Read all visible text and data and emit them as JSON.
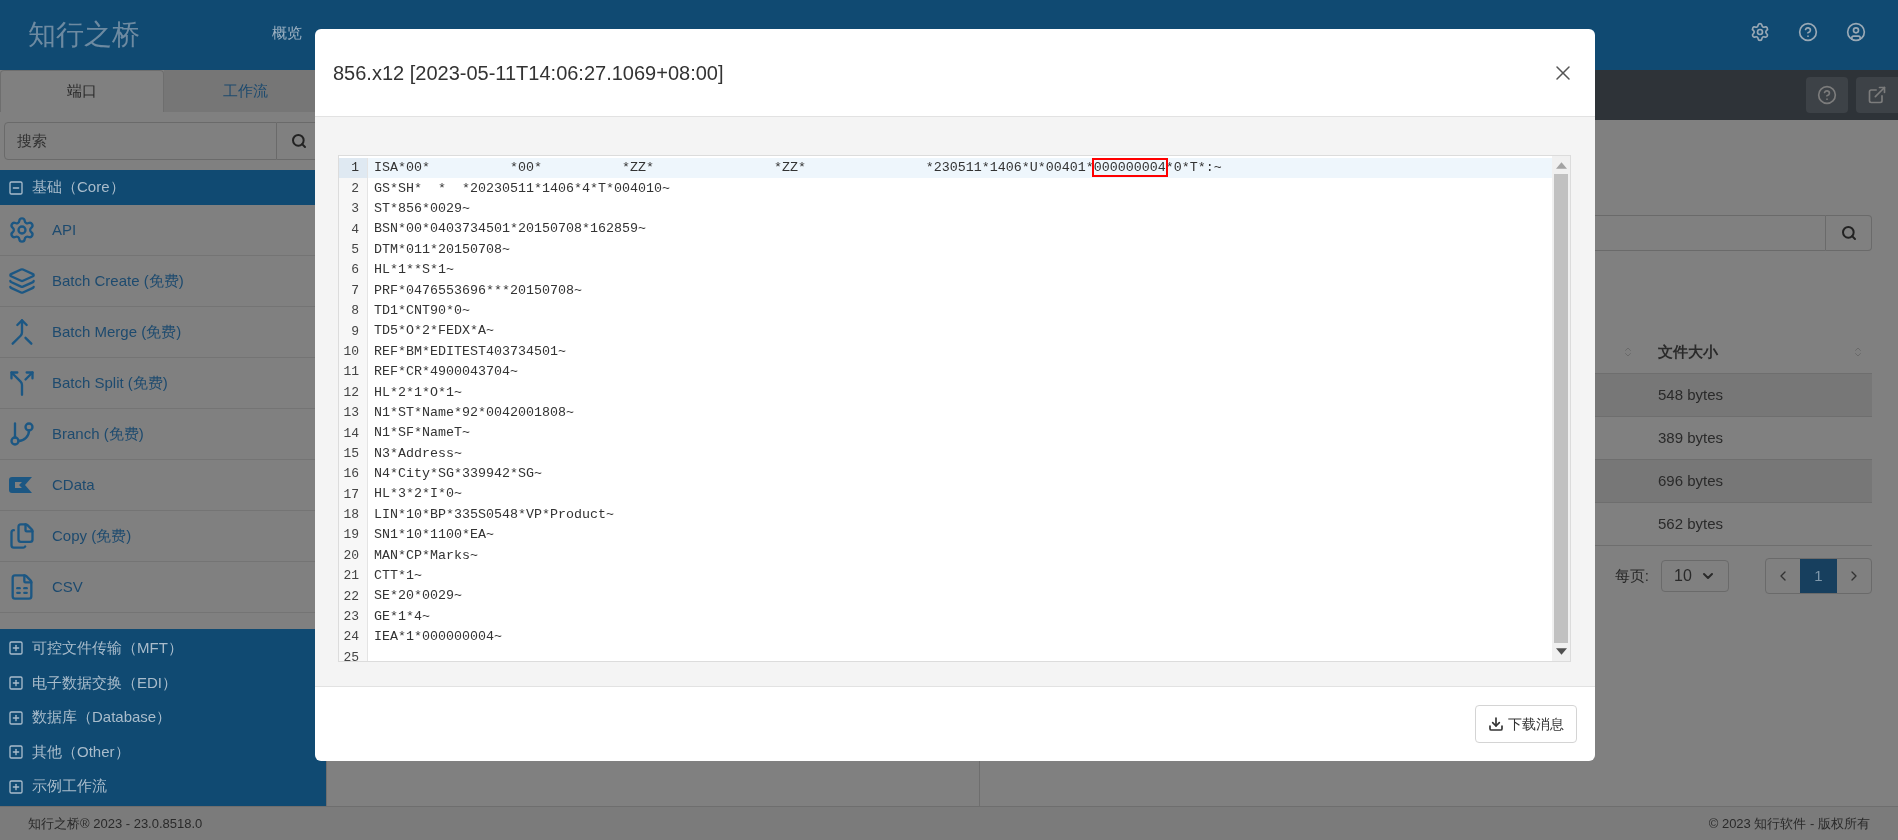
{
  "header": {
    "logo": "知行之桥",
    "nav": [
      {
        "label": "概览",
        "selected": false
      }
    ]
  },
  "sidebar": {
    "tabs": [
      {
        "label": "端口",
        "selected": true
      },
      {
        "label": "工作流",
        "selected": false
      }
    ],
    "search": {
      "placeholder": "搜索"
    },
    "groups": [
      {
        "label": "基础（Core）",
        "expanded": true,
        "items": [
          {
            "kind": "api",
            "label": "API"
          },
          {
            "kind": "batch-create",
            "label": "Batch Create (免费)"
          },
          {
            "kind": "batch-merge",
            "label": "Batch Merge (免费)"
          },
          {
            "kind": "batch-split",
            "label": "Batch Split (免费)"
          },
          {
            "kind": "branch",
            "label": "Branch (免费)"
          },
          {
            "kind": "cdata",
            "label": "CData"
          },
          {
            "kind": "copy",
            "label": "Copy (免费)"
          },
          {
            "kind": "csv",
            "label": "CSV"
          }
        ]
      },
      {
        "label": "可控文件传输（MFT）",
        "expanded": false
      },
      {
        "label": "电子数据交换（EDI）",
        "expanded": false
      },
      {
        "label": "数据库（Database）",
        "expanded": false
      },
      {
        "label": "其他（Other）",
        "expanded": false
      },
      {
        "label": "示例工作流",
        "expanded": false
      }
    ]
  },
  "main": {
    "table": {
      "columns": [
        "文件大小"
      ],
      "rows": [
        "548 bytes",
        "389 bytes",
        "696 bytes",
        "562 bytes"
      ]
    },
    "pagination": {
      "per_page_label": "每页:",
      "per_page": "10",
      "pages": [
        {
          "label": "1",
          "selected": true
        }
      ]
    }
  },
  "modal": {
    "title": "856.x12 [2023-05-11T14:06:27.1069+08:00]",
    "lines": [
      {
        "number": "1",
        "selected": true,
        "segments": [
          {
            "text": "ISA*00*          *00*          *ZZ*               *ZZ*               *230511*1406*U*00401*",
            "marked": false
          },
          {
            "text": "000000004",
            "marked": true
          },
          {
            "text": "*0*T*:~",
            "marked": false
          }
        ]
      },
      {
        "number": "2",
        "selected": false,
        "segments": [
          {
            "text": "GS*SH*  *  *20230511*1406*4*T*004010~",
            "marked": false
          }
        ]
      },
      {
        "number": "3",
        "selected": false,
        "segments": [
          {
            "text": "ST*856*0029~",
            "marked": false
          }
        ]
      },
      {
        "number": "4",
        "selected": false,
        "segments": [
          {
            "text": "BSN*00*0403734501*20150708*162859~",
            "marked": false
          }
        ]
      },
      {
        "number": "5",
        "selected": false,
        "segments": [
          {
            "text": "DTM*011*20150708~",
            "marked": false
          }
        ]
      },
      {
        "number": "6",
        "selected": false,
        "segments": [
          {
            "text": "HL*1**S*1~",
            "marked": false
          }
        ]
      },
      {
        "number": "7",
        "selected": false,
        "segments": [
          {
            "text": "PRF*0476553696***20150708~",
            "marked": false
          }
        ]
      },
      {
        "number": "8",
        "selected": false,
        "segments": [
          {
            "text": "TD1*CNT90*0~",
            "marked": false
          }
        ]
      },
      {
        "number": "9",
        "selected": false,
        "segments": [
          {
            "text": "TD5*O*2*FEDX*A~",
            "marked": false
          }
        ]
      },
      {
        "number": "10",
        "selected": false,
        "segments": [
          {
            "text": "REF*BM*EDITEST403734501~",
            "marked": false
          }
        ]
      },
      {
        "number": "11",
        "selected": false,
        "segments": [
          {
            "text": "REF*CR*4900043704~",
            "marked": false
          }
        ]
      },
      {
        "number": "12",
        "selected": false,
        "segments": [
          {
            "text": "HL*2*1*O*1~",
            "marked": false
          }
        ]
      },
      {
        "number": "13",
        "selected": false,
        "segments": [
          {
            "text": "N1*ST*Name*92*0042001808~",
            "marked": false
          }
        ]
      },
      {
        "number": "14",
        "selected": false,
        "segments": [
          {
            "text": "N1*SF*NameT~",
            "marked": false
          }
        ]
      },
      {
        "number": "15",
        "selected": false,
        "segments": [
          {
            "text": "N3*Address~",
            "marked": false
          }
        ]
      },
      {
        "number": "16",
        "selected": false,
        "segments": [
          {
            "text": "N4*City*SG*339942*SG~",
            "marked": false
          }
        ]
      },
      {
        "number": "17",
        "selected": false,
        "segments": [
          {
            "text": "HL*3*2*I*0~",
            "marked": false
          }
        ]
      },
      {
        "number": "18",
        "selected": false,
        "segments": [
          {
            "text": "LIN*10*BP*335S0548*VP*Product~",
            "marked": false
          }
        ]
      },
      {
        "number": "19",
        "selected": false,
        "segments": [
          {
            "text": "SN1*10*1100*EA~",
            "marked": false
          }
        ]
      },
      {
        "number": "20",
        "selected": false,
        "segments": [
          {
            "text": "MAN*CP*Marks~",
            "marked": false
          }
        ]
      },
      {
        "number": "21",
        "selected": false,
        "segments": [
          {
            "text": "CTT*1~",
            "marked": false
          }
        ]
      },
      {
        "number": "22",
        "selected": false,
        "segments": [
          {
            "text": "SE*20*0029~",
            "marked": false
          }
        ]
      },
      {
        "number": "23",
        "selected": false,
        "segments": [
          {
            "text": "GE*1*4~",
            "marked": false
          }
        ]
      },
      {
        "number": "24",
        "selected": false,
        "segments": [
          {
            "text": "IEA*1*000000004~",
            "marked": false
          }
        ]
      },
      {
        "number": "25",
        "selected": false
      }
    ],
    "button": "下载消息"
  },
  "footer": {
    "left": "知行之桥® 2023 - 23.0.8518.0",
    "right": "© 2023 知行软件 - 版权所有"
  }
}
